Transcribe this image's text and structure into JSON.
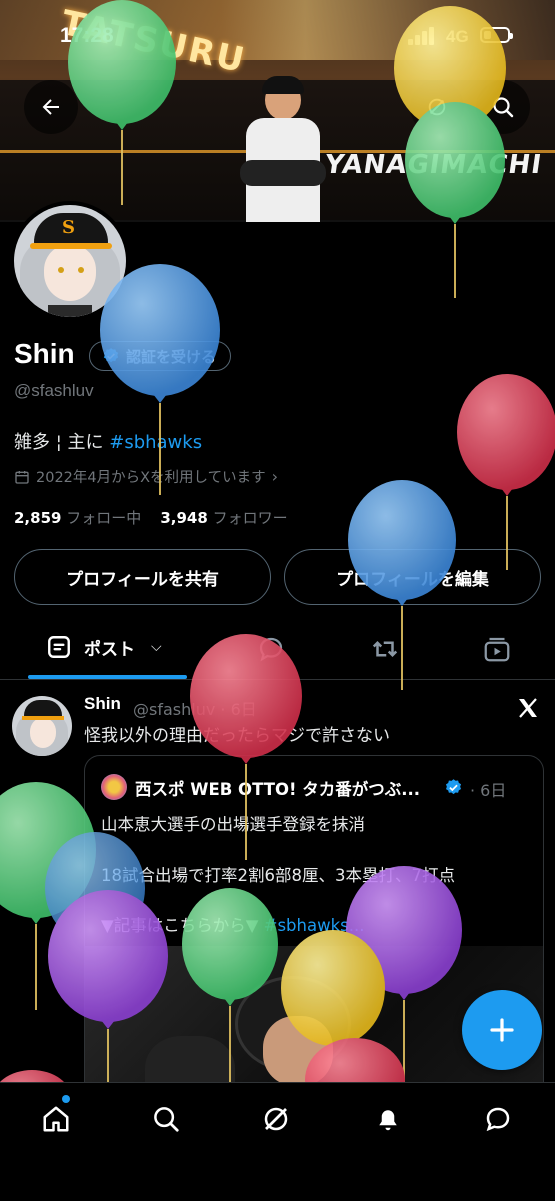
{
  "status_bar": {
    "time": "17:28",
    "network": "4G"
  },
  "banner": {
    "text_left": "TATSURU",
    "text_right": "YANAGIMACHI"
  },
  "header": {
    "back_icon": "arrow-left-icon",
    "search_icon": "search-icon"
  },
  "profile": {
    "name": "Shin",
    "verify_label": "認証を受ける",
    "handle": "@sfashluv",
    "bio_text": "雑多 ¦ 主に ",
    "bio_hashtag": "#sbhawks",
    "joined": "2022年4月からXを利用しています",
    "following_count": "2,859",
    "following_label": "フォロー中",
    "followers_count": "3,948",
    "followers_label": "フォロワー",
    "share_button": "プロフィールを共有",
    "edit_button": "プロフィールを編集"
  },
  "tabs": [
    {
      "label": "ポスト",
      "icon": "post-icon"
    },
    {
      "label": "",
      "icon": "reply-icon"
    },
    {
      "label": "",
      "icon": "repost-icon"
    },
    {
      "label": "",
      "icon": "media-icon"
    }
  ],
  "post": {
    "author": "Shin",
    "handle_time": "@sfashluv · 6日",
    "text": "怪我以外の理由だったらマジで許さない",
    "quote": {
      "author": "西スポ WEB OTTO! タカ番がつぶ...",
      "time": "· 6日",
      "line1": "山本恵大選手の出場選手登録を抹消",
      "line2": "18試合出場で打率2割6部8厘、3本塁打、7打点",
      "line3": "▼記事はこちらから▼ ",
      "line3_tag": "#sbhawks..."
    }
  },
  "fab": {
    "icon": "plus-icon"
  },
  "bottom_nav": [
    "home-icon",
    "search-icon",
    "grok-icon",
    "notifications-icon",
    "messages-icon"
  ],
  "colors": {
    "accent": "#1d9bf0",
    "background": "#000000",
    "muted": "#71767b"
  }
}
